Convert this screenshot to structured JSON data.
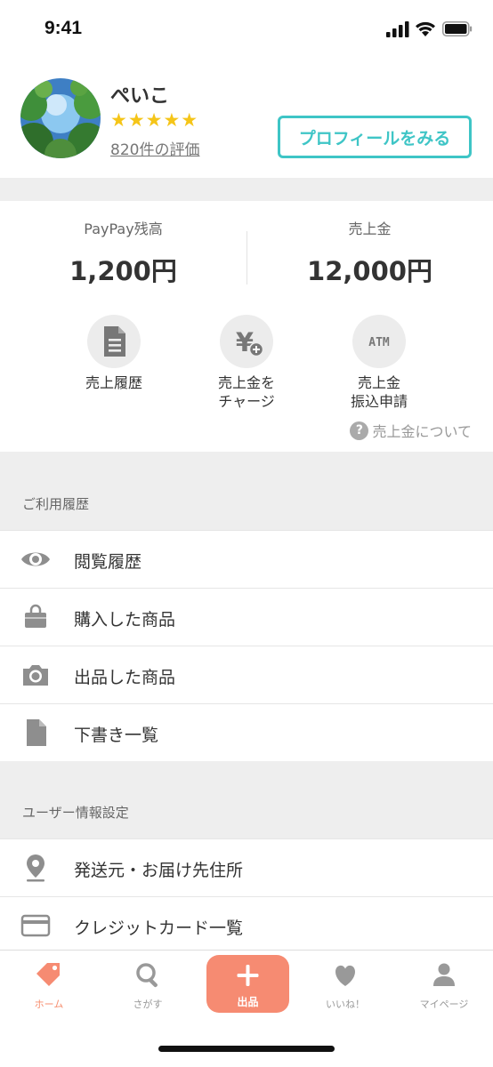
{
  "status_bar": {
    "time": "9:41"
  },
  "profile": {
    "name": "ぺいこ",
    "rating_stars": 5,
    "stars_text": "★★★★★",
    "reviews": "820件の評価",
    "view_profile_button": "プロフィールをみる"
  },
  "balances": {
    "paypay_label": "PayPay残高",
    "paypay_value": "1,200円",
    "sales_label": "売上金",
    "sales_value": "12,000円"
  },
  "actions": [
    {
      "label": "売上履歴",
      "icon": "document-icon"
    },
    {
      "label": "売上金を\nチャージ",
      "icon": "yen-plus-icon"
    },
    {
      "label": "売上金\n振込申請",
      "icon": "atm-icon"
    }
  ],
  "about_sales": "売上金について",
  "usage_section": {
    "title": "ご利用履歴",
    "items": [
      {
        "label": "閲覧履歴",
        "icon": "eye-icon"
      },
      {
        "label": "購入した商品",
        "icon": "shopping-bag-icon"
      },
      {
        "label": "出品した商品",
        "icon": "camera-icon"
      },
      {
        "label": "下書き一覧",
        "icon": "file-icon"
      }
    ]
  },
  "user_section": {
    "title": "ユーザー情報設定",
    "items": [
      {
        "label": "発送元・お届け先住所",
        "icon": "location-pin-icon"
      },
      {
        "label": "クレジットカード一覧",
        "icon": "credit-card-icon"
      }
    ]
  },
  "tabbar": {
    "items": [
      {
        "label": "ホーム",
        "icon": "tag-icon",
        "active": true
      },
      {
        "label": "さがす",
        "icon": "search-icon",
        "active": false
      },
      {
        "label": "出品",
        "icon": "plus-icon",
        "active": false
      },
      {
        "label": "いいね！",
        "icon": "heart-icon",
        "active": false
      },
      {
        "label": "マイページ",
        "icon": "person-icon",
        "active": false
      }
    ]
  },
  "colors": {
    "accent_teal": "#3ec5c6",
    "accent_orange": "#f68b72",
    "star": "#f5c518",
    "icon_gray": "#8e8e8e"
  }
}
